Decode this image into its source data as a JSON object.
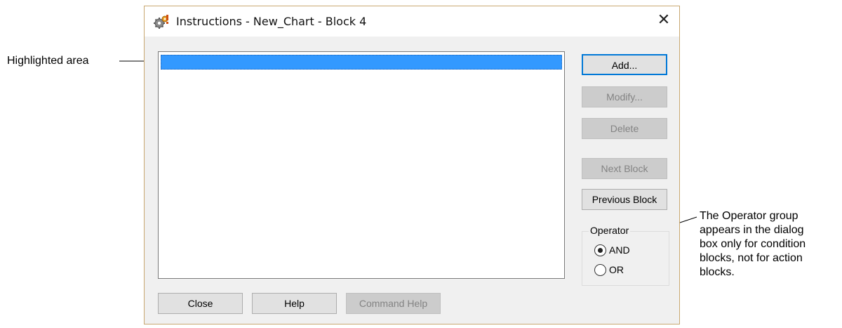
{
  "annotations": {
    "left_callout": "Highlighted area",
    "right_callout_lines": [
      "The Operator group",
      "appears in the dialog",
      "box only for condition",
      "blocks, not for action",
      "blocks."
    ]
  },
  "dialog": {
    "title": "Instructions - New_Chart - Block 4",
    "close_glyph": "✕",
    "buttons": {
      "add": "Add...",
      "modify": "Modify...",
      "delete": "Delete",
      "next_block": "Next Block",
      "previous_block": "Previous Block",
      "close": "Close",
      "help": "Help",
      "command_help": "Command Help"
    },
    "operator_group": {
      "label": "Operator",
      "options": [
        "AND",
        "OR"
      ],
      "selected": "AND"
    },
    "colors": {
      "highlight": "#3399ff",
      "default_button_border": "#0078d7"
    },
    "icons": [
      "gears-icon",
      "close-icon"
    ]
  }
}
